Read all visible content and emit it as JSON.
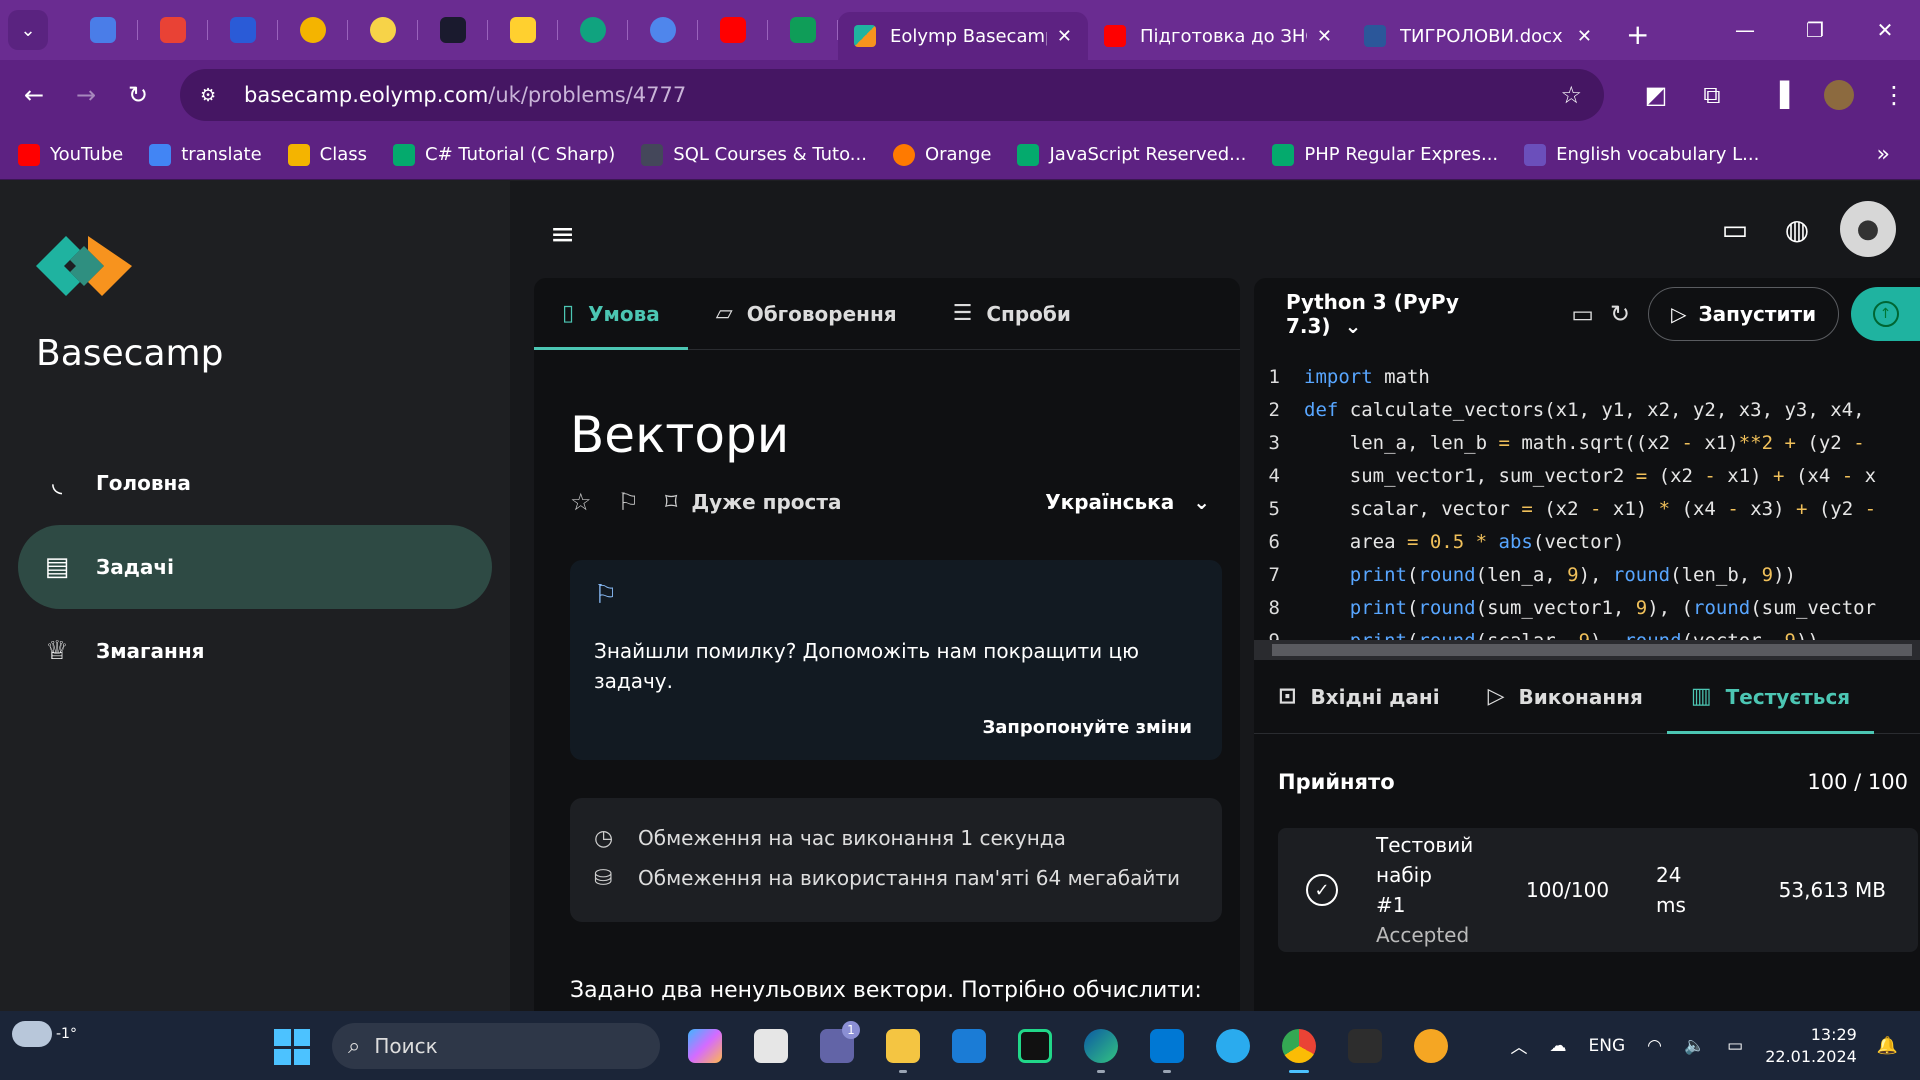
{
  "browser": {
    "tabs": [
      {
        "label": "Eolymp Basecamp",
        "active": true
      },
      {
        "label": "Підготовка до ЗНО",
        "active": false
      },
      {
        "label": "ТИГРОЛОВИ.docx",
        "active": false
      }
    ],
    "url_host": "basecamp.eolymp.com",
    "url_path": "/uk/problems/4777",
    "bookmarks": [
      "YouTube",
      "translate",
      "Class",
      "C# Tutorial (C Sharp)",
      "SQL Courses & Tuto...",
      "Orange",
      "JavaScript Reserved...",
      "PHP Regular Expres...",
      "English vocabulary L..."
    ]
  },
  "sidebar": {
    "brand": "Basecamp",
    "items": [
      {
        "label": "Головна"
      },
      {
        "label": "Задачі"
      },
      {
        "label": "Змагання"
      }
    ]
  },
  "problem": {
    "tabs": [
      "Умова",
      "Обговорення",
      "Спроби"
    ],
    "title": "Вектори",
    "difficulty": "Дуже проста",
    "language": "Українська",
    "feedback_text": "Знайшли помилку? Допоможіть нам покращити цю задачу.",
    "feedback_link": "Запропонуйте зміни",
    "time_limit": "Обмеження на час виконання 1 секунда",
    "memory_limit": "Обмеження на використання пам'яті 64 мегабайти",
    "description_start": "Задано два ненульових вектори. Потрібно обчислити:"
  },
  "editor": {
    "language": "Python 3 (PyPy 7.3)",
    "run_label": "Запустити",
    "output_tabs": [
      "Вхідні дані",
      "Виконання",
      "Тестується"
    ],
    "result": "Прийнято",
    "score": "100 / 100",
    "tests": [
      {
        "name": "Тестовий набір",
        "number": "#1",
        "status": "Accepted",
        "score": "100/100",
        "time": "24",
        "time_unit": "ms",
        "memory": "53,613 MB"
      }
    ]
  },
  "taskbar": {
    "temperature": "-1°",
    "search_placeholder": "Поиск",
    "language": "ENG",
    "time": "13:29",
    "date": "22.01.2024",
    "badge_count": "1"
  },
  "colors": {
    "browser_frame": "#6a2c91",
    "accent_teal": "#4cc6b3",
    "sidebar_active": "#2e4a44"
  }
}
